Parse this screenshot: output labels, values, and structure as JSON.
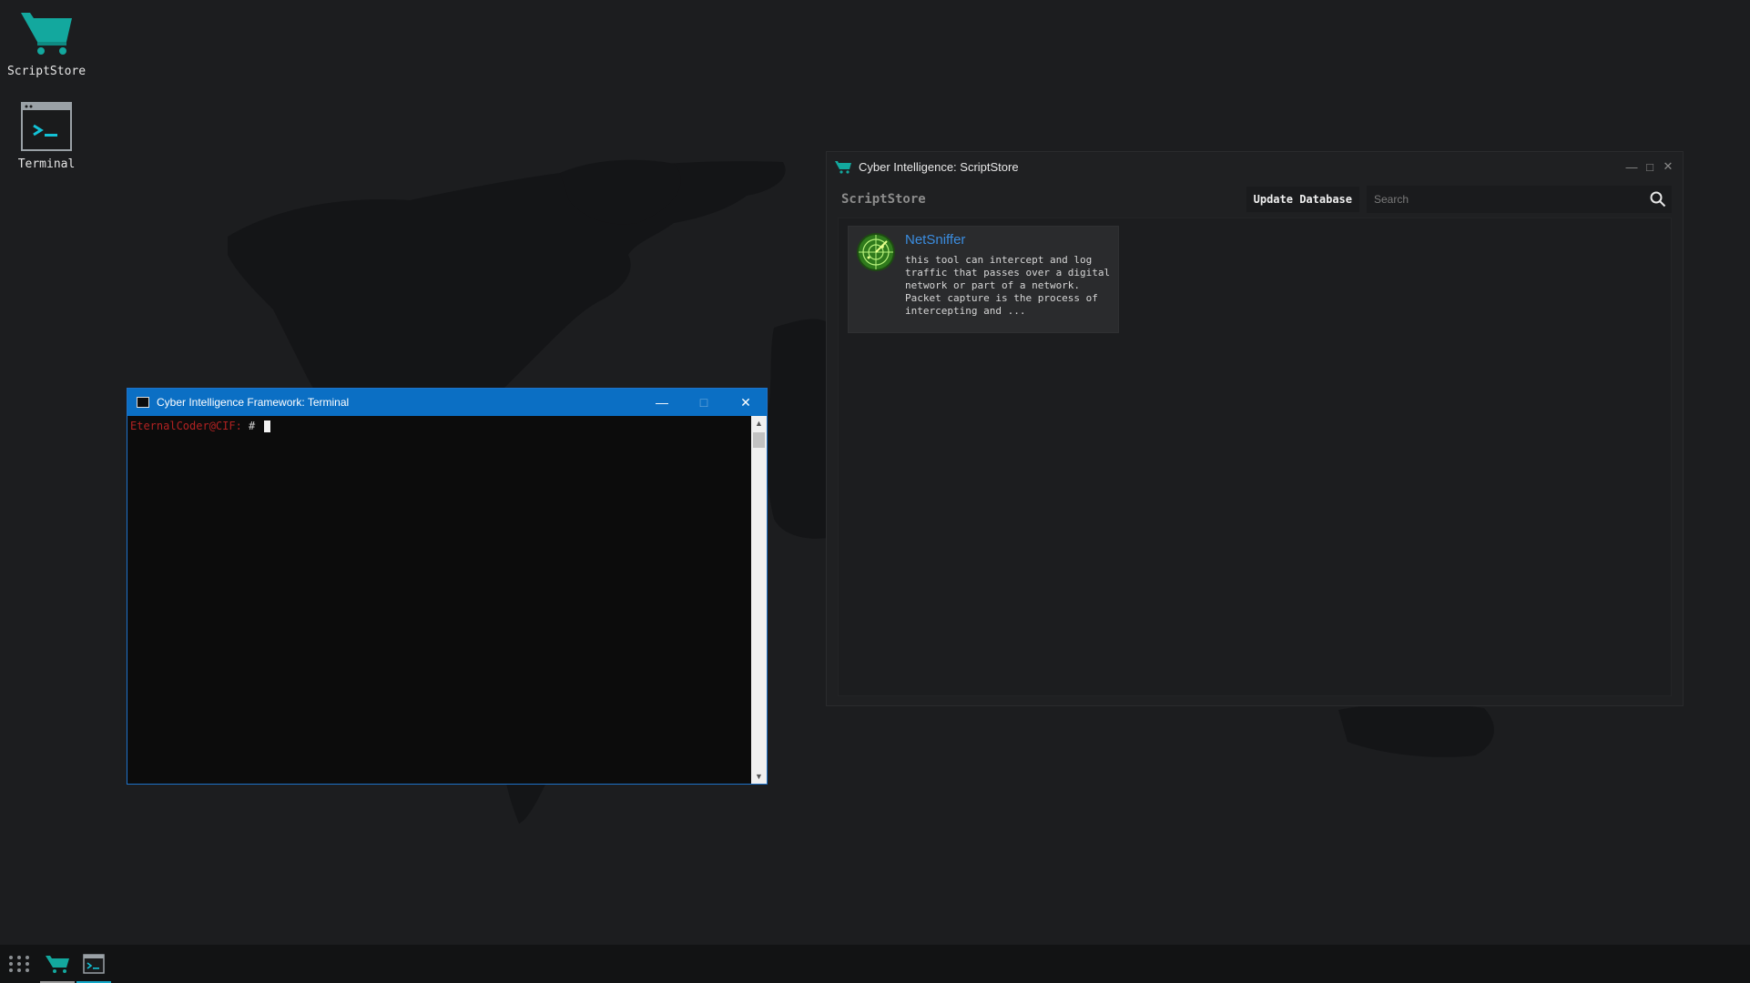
{
  "desktop": {
    "icons": [
      {
        "label": "ScriptStore",
        "icon": "cart-icon"
      },
      {
        "label": "Terminal",
        "icon": "terminal-icon"
      }
    ]
  },
  "terminal": {
    "title": "Cyber Intelligence Framework: Terminal",
    "prompt_user": "EternalCoder@CIF:",
    "prompt_symbol": " #"
  },
  "store": {
    "title": "Cyber Intelligence: ScriptStore",
    "brand": "ScriptStore",
    "update_button": "Update Database",
    "search_placeholder": "Search",
    "items": [
      {
        "name": "NetSniffer",
        "description": "this tool can intercept and log traffic that passes over a digital network or part of a network. Packet capture is the process of intercepting and ..."
      }
    ]
  },
  "taskbar": {
    "items": [
      "apps-grid-icon",
      "cart-icon",
      "terminal-icon"
    ]
  },
  "colors": {
    "accent_teal": "#13a89e",
    "terminal_title_bar": "#0b6fc4",
    "link_blue": "#3b8de0",
    "prompt_red": "#b22222"
  }
}
